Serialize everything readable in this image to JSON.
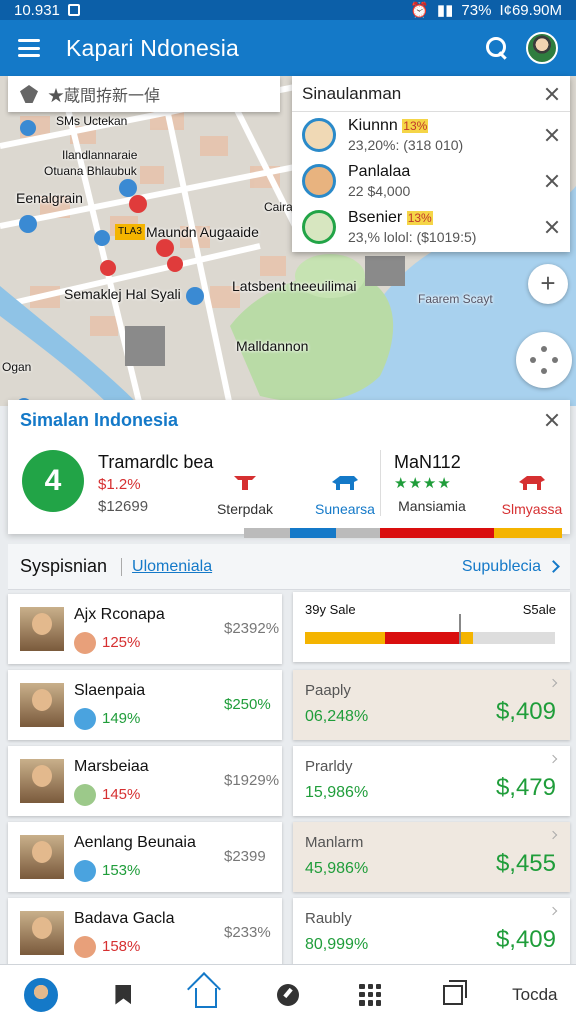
{
  "status": {
    "time": "10.931",
    "battery": "73%",
    "right_text": "I¢69.90M"
  },
  "appbar": {
    "title": "Kapari Ndonesia"
  },
  "map": {
    "search_text": "★蔵間拵新一倬",
    "labels": [
      "SMs Uctekan",
      "Ilandlannaraie",
      "Otuana Bhlaubuk",
      "Eenalgrain",
      "Caira",
      "Maundn Augaaide",
      "Semaklej Hal Syali",
      "Latsbent tneeuilimai",
      "Malldannon",
      "Ogan",
      "Faarem Scayt"
    ],
    "poi_badge": "TLA3"
  },
  "suggest": {
    "title": "Sinaulanman",
    "items": [
      {
        "name": "Kiunnn",
        "tag": "13%",
        "sub": "23,20%: (318 010)",
        "color": "#2b8ac9"
      },
      {
        "name": "Panlalaa",
        "tag": "",
        "sub": "22 $4,000",
        "color": "#2b8ac9"
      },
      {
        "name": "Bsenier",
        "tag": "13%",
        "sub": "23,% lolol: ($1019:5)",
        "color": "#22a447"
      }
    ]
  },
  "summary": {
    "title": "Simalan Indonesia",
    "badge": "4",
    "metric_name": "Tramardlc bea",
    "metric_pct": "$1.2%",
    "metric_val": "$12699",
    "cols": [
      {
        "label": "Sterpdak",
        "color": "#d63031"
      },
      {
        "label": "Sunearsa",
        "color": "#1479c8"
      }
    ],
    "right_title": "MaN112",
    "stars": "★★★★",
    "right_cols": [
      {
        "label": "Mansiamia",
        "color": "#777777"
      },
      {
        "label": "Slmyassa",
        "color": "#d63031"
      }
    ]
  },
  "section": {
    "title": "Syspisnian",
    "sub": "Ulomeniala",
    "link": "Supublecia"
  },
  "people": [
    {
      "name": "Ajx Rconapa",
      "pct": "125%",
      "pct_color": "#d63031",
      "value": "$2392%"
    },
    {
      "name": "Slaenpaia",
      "pct": "149%",
      "pct_color": "#1f9d3a",
      "value": "$250%"
    },
    {
      "name": "Marsbeiaa",
      "pct": "145%",
      "pct_color": "#d63031",
      "value": "$1929%"
    },
    {
      "name": "Aenlang Beunaia",
      "pct": "153%",
      "pct_color": "#1f9d3a",
      "value": "$2399"
    },
    {
      "name": "Badava Gacla",
      "pct": "158%",
      "pct_color": "#d63031",
      "value": "$233%"
    }
  ],
  "sale": {
    "left": "39y Sale",
    "right": "S5ale"
  },
  "prices": [
    {
      "label": "Paaply",
      "pct": "06,248%",
      "big": "$,409",
      "bg": "#efe8e0"
    },
    {
      "label": "Prarldy",
      "pct": "15,986%",
      "big": "$,479",
      "bg": "#ffffff"
    },
    {
      "label": "Manlarm",
      "pct": "45,986%",
      "big": "$,455",
      "bg": "#efe8e0"
    },
    {
      "label": "Raubly",
      "pct": "80,999%",
      "big": "$,409",
      "bg": "#ffffff"
    }
  ],
  "bottomnav": {
    "text": "Tocda"
  }
}
